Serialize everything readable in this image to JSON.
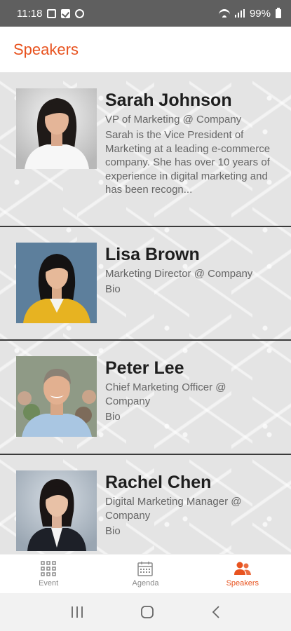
{
  "status_bar": {
    "time": "11:18",
    "battery": "99%",
    "icons": [
      "image-icon",
      "check-icon",
      "circle-icon",
      "wifi-icon",
      "signal-icon",
      "battery-icon"
    ]
  },
  "header": {
    "title": "Speakers"
  },
  "colors": {
    "accent": "#e8531f",
    "divider": "#3a3a3a"
  },
  "speakers": [
    {
      "name": "Sarah Johnson",
      "role": "VP of Marketing @ Company",
      "bio": "Sarah is the Vice President of Marketing at a leading e-commerce company. She has over 10 years of experience in digital marketing and has been recogn..."
    },
    {
      "name": "Lisa Brown",
      "role": "Marketing Director @ Company",
      "bio": "Bio"
    },
    {
      "name": "Peter Lee",
      "role": "Chief Marketing Officer @ Company",
      "bio": "Bio"
    },
    {
      "name": "Rachel Chen",
      "role": "Digital Marketing Manager @ Company",
      "bio": "Bio"
    }
  ],
  "bottom_nav": [
    {
      "label": "Event",
      "icon": "grid-icon",
      "active": false
    },
    {
      "label": "Agenda",
      "icon": "calendar-icon",
      "active": false
    },
    {
      "label": "Speakers",
      "icon": "people-icon",
      "active": true
    }
  ],
  "system_nav": {
    "icons": [
      "recents-icon",
      "home-icon",
      "back-icon"
    ]
  }
}
